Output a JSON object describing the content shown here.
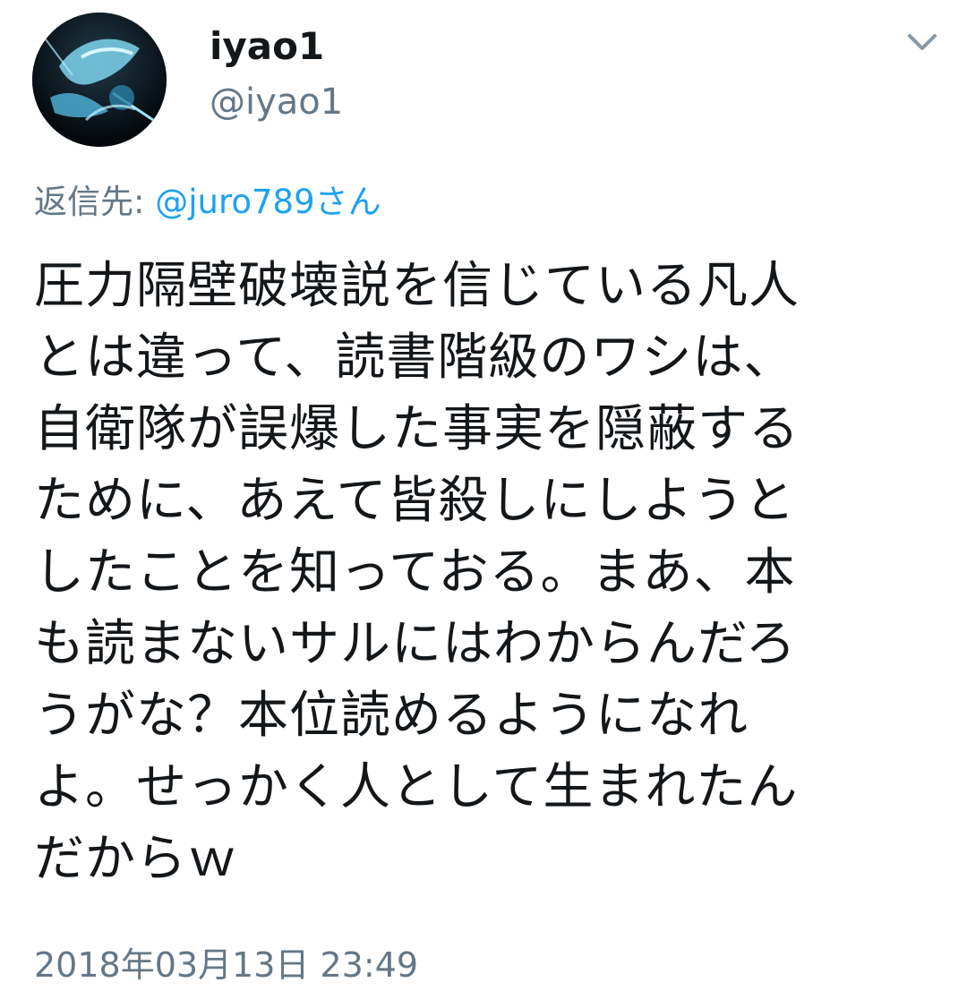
{
  "tweet": {
    "author": {
      "display_name": "iyao1",
      "handle": "@iyao1"
    },
    "reply_to": {
      "label": "返信先: ",
      "target": "@juro789さん"
    },
    "text_lines": [
      "圧力隔壁破壊説を信じている凡人",
      "とは違って、読書階級のワシは、",
      "自衛隊が誤爆した事実を隠蔽する",
      "ために、あえて皆殺しにしようと",
      "したことを知っておる。まあ、本",
      "も読まないサルにはわからんだろ",
      "うがな？本位読めるようになれ",
      "よ。せっかく人として生まれたん",
      "だからｗ"
    ],
    "timestamp": "2018年03月13日 23:49"
  },
  "icons": {
    "avatar": "avatar-image",
    "menu": "chevron-down-icon"
  },
  "colors": {
    "primary_text": "#14171a",
    "secondary_text": "#657786",
    "link": "#1da1f2",
    "background": "#ffffff"
  }
}
